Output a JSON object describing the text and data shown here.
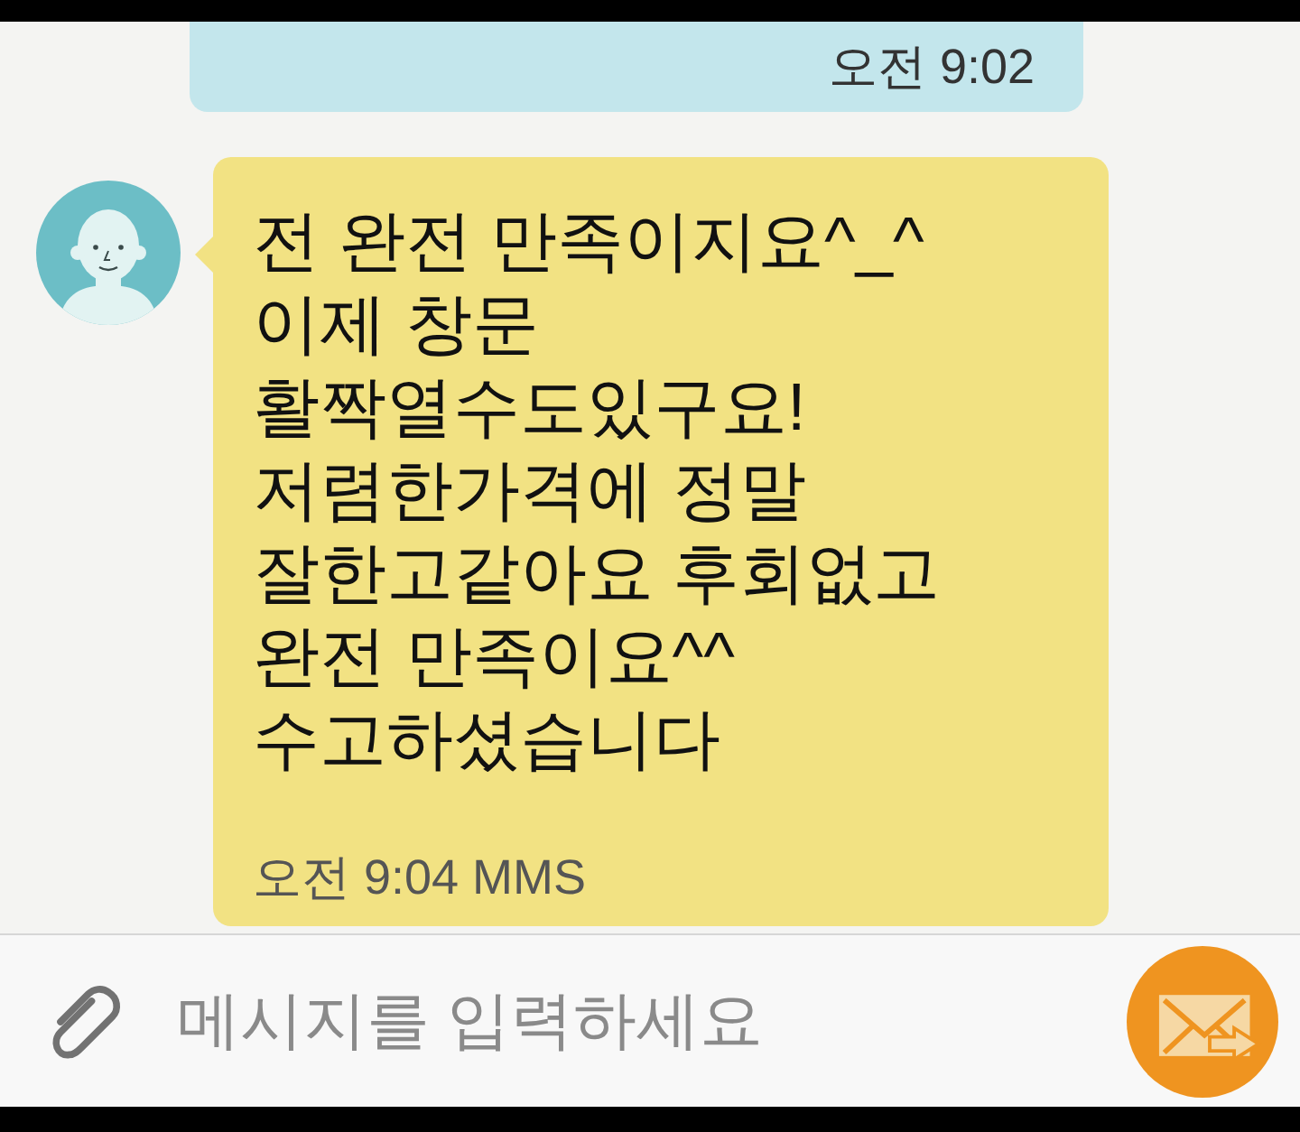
{
  "messages": [
    {
      "kind": "sent",
      "time": "오전 9:02"
    },
    {
      "kind": "received",
      "text": "전 완전 만족이지요^_^\n이제 창문\n활짝열수도있구요!\n저렴한가격에 정말\n잘한고같아요 후회없고\n완전 만족이요^^\n수고하셨습니다",
      "time": "오전 9:04 MMS"
    }
  ],
  "composer": {
    "placeholder": "메시지를 입력하세요"
  }
}
